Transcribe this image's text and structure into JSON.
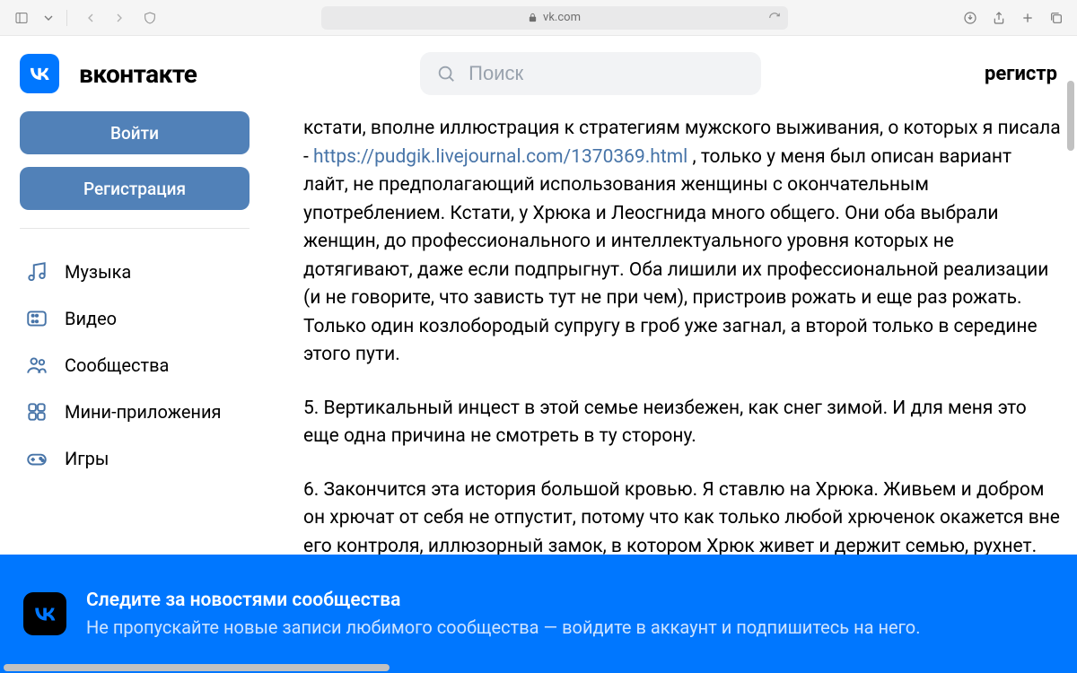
{
  "browser": {
    "url": "vk.com"
  },
  "brand": "вконтакте",
  "search": {
    "placeholder": "Поиск"
  },
  "register_link": "регистр",
  "sidebar": {
    "login": "Войти",
    "register": "Регистрация",
    "nav": [
      {
        "label": "Музыка",
        "icon": "music"
      },
      {
        "label": "Видео",
        "icon": "video"
      },
      {
        "label": "Сообщества",
        "icon": "communities"
      },
      {
        "label": "Мини-приложения",
        "icon": "apps"
      },
      {
        "label": "Игры",
        "icon": "games"
      }
    ]
  },
  "article": {
    "p1_pre": "кстати, вполне иллюстрация к стратегиям мужского выживания, о которых я писала - ",
    "p1_link": "https://pudgik.livejournal.com/1370369.html",
    "p1_post": " , только у меня был описан вариант лайт, не предполагающий использования женщины с окончательным употреблением. Кстати, у Хрюка и Леосгнида много общего. Они оба выбрали женщин, до профессионального и интеллектуального уровня которых не дотягивают, даже если подпрыгнут. Оба лишили их профессиональной реализации (и не говорите, что зависть тут не при чем), пристроив рожать и еще раз рожать. Только один козлобородый супругу в гроб уже загнал, а второй только в середине этого пути.",
    "p2": "5. Вертикальный инцест в этой семье неизбежен, как снег зимой. И для меня это еще одна причина не смотреть в ту сторону.",
    "p3": "6. Закончится эта история большой кровью. Я ставлю на Хрюка. Живьем и добром он хрючат от себя не отпустит, потому что как только любой хрюченок окажется вне его контроля, иллюзорный замок, в котором Хрюк живет и держит семью, рухнет. Учитывая, что нарушения мышления в его, гхм, текстах все очевиднее, агрессию он"
  },
  "banner": {
    "title": "Следите за новостями сообщества",
    "subtitle": "Не пропускайте новые записи любимого сообщества — войдите в аккаунт и подпишитесь на него."
  }
}
